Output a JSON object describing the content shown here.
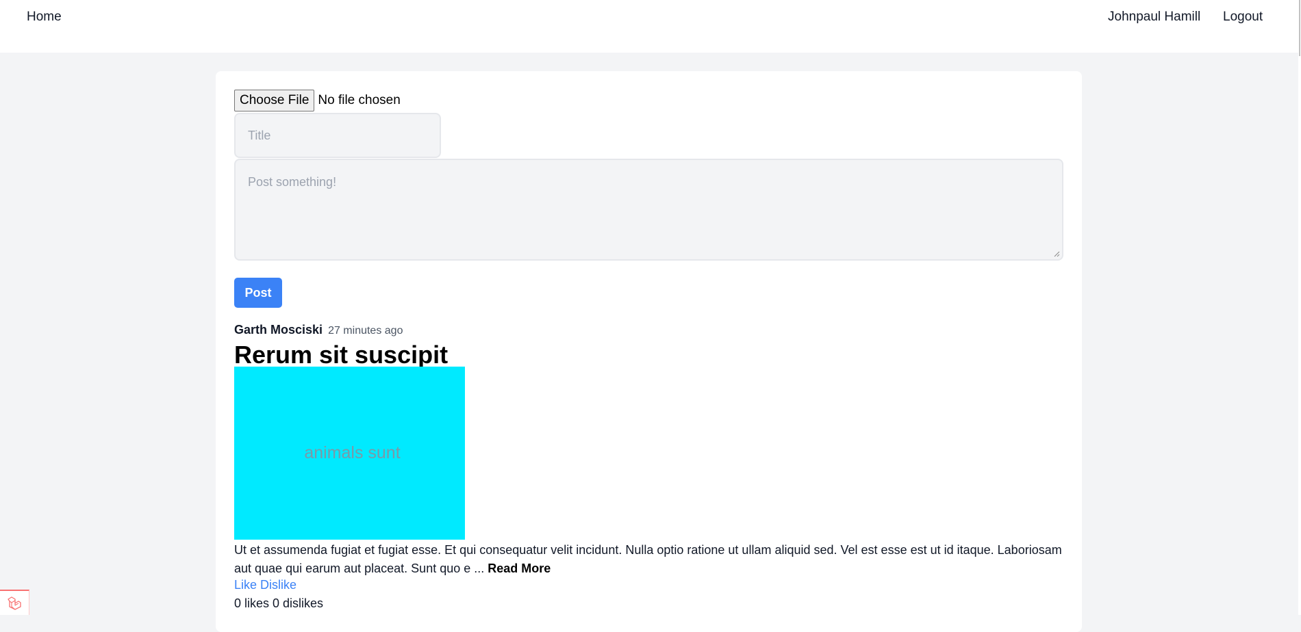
{
  "nav": {
    "home": "Home",
    "user": "Johnpaul Hamill",
    "logout": "Logout"
  },
  "composer": {
    "file_button": "Choose File",
    "file_status": "No file chosen",
    "title_placeholder": "Title",
    "post_placeholder": "Post something!",
    "submit_label": "Post"
  },
  "post": {
    "author": "Garth Mosciski",
    "time": "27 minutes ago",
    "title": "Rerum sit suscipit",
    "image_text": "animals sunt",
    "image_color": "#00eaff",
    "body": "Ut et assumenda fugiat et fugiat esse. Et qui consequatur velit incidunt. Nulla optio ratione ut ullam aliquid sed. Vel est esse est ut id itaque. Laboriosam aut quae qui earum aut placeat. Sunt quo e ... ",
    "read_more": "Read More",
    "like": "Like",
    "dislike": "Dislike",
    "counts": "0 likes 0 dislikes"
  },
  "colors": {
    "accent": "#3b82f6",
    "page_bg": "#f3f4f6"
  }
}
